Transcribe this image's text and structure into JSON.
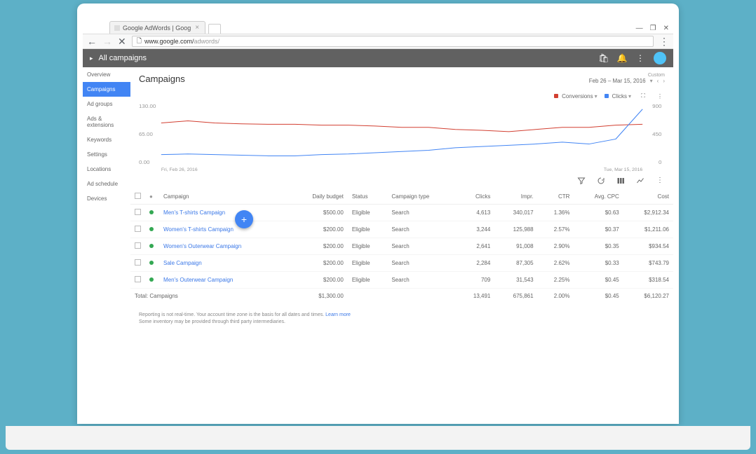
{
  "browser": {
    "tab_title": "Google AdWords | Goog",
    "url_host": "www.google.com/",
    "url_path": "adwords/"
  },
  "header": {
    "title": "All campaigns"
  },
  "sidebar": {
    "items": [
      {
        "label": "Overview",
        "active": false
      },
      {
        "label": "Campaigns",
        "active": true
      },
      {
        "label": "Ad groups",
        "active": false
      },
      {
        "label": "Ads & extensions",
        "active": false
      },
      {
        "label": "Keywords",
        "active": false
      },
      {
        "label": "Settings",
        "active": false
      },
      {
        "label": "Locations",
        "active": false
      },
      {
        "label": "Ad schedule",
        "active": false
      },
      {
        "label": "Devices",
        "active": false
      }
    ]
  },
  "page": {
    "title": "Campaigns",
    "date_label": "Custom",
    "date_range": "Feb 26 – Mar 15, 2016"
  },
  "chart_data": {
    "type": "line",
    "x_start": "Fri, Feb 26, 2016",
    "x_end": "Tue, Mar 15, 2016",
    "left_axis": {
      "label": "Conversions",
      "color": "#d23f31",
      "ticks": [
        0.0,
        65.0,
        130.0
      ]
    },
    "right_axis": {
      "label": "Clicks",
      "color": "#4285f4",
      "ticks": [
        0,
        450,
        900
      ]
    },
    "series": [
      {
        "name": "Conversions",
        "axis": "left",
        "color": "#d23f31",
        "values": [
          95,
          100,
          95,
          93,
          92,
          92,
          90,
          90,
          88,
          85,
          85,
          80,
          78,
          75,
          80,
          85,
          85,
          90,
          92
        ]
      },
      {
        "name": "Clicks",
        "axis": "right",
        "color": "#4285f4",
        "values": [
          150,
          160,
          150,
          140,
          130,
          130,
          150,
          160,
          180,
          200,
          220,
          260,
          280,
          300,
          320,
          350,
          320,
          400,
          880
        ]
      }
    ]
  },
  "table": {
    "columns": [
      "",
      "",
      "Campaign",
      "Daily budget",
      "Status",
      "Campaign type",
      "Clicks",
      "Impr.",
      "CTR",
      "Avg. CPC",
      "Cost"
    ],
    "rows": [
      {
        "name": "Men's T-shirts Campaign",
        "budget": "$500.00",
        "status": "Eligible",
        "type": "Search",
        "clicks": "4,613",
        "impr": "340,017",
        "ctr": "1.36%",
        "cpc": "$0.63",
        "cost": "$2,912.34"
      },
      {
        "name": "Women's T-shirts Campaign",
        "budget": "$200.00",
        "status": "Eligible",
        "type": "Search",
        "clicks": "3,244",
        "impr": "125,988",
        "ctr": "2.57%",
        "cpc": "$0.37",
        "cost": "$1,211.06"
      },
      {
        "name": "Women's Outerwear Campaign",
        "budget": "$200.00",
        "status": "Eligible",
        "type": "Search",
        "clicks": "2,641",
        "impr": "91,008",
        "ctr": "2.90%",
        "cpc": "$0.35",
        "cost": "$934.54"
      },
      {
        "name": "Sale Campaign",
        "budget": "$200.00",
        "status": "Eligible",
        "type": "Search",
        "clicks": "2,284",
        "impr": "87,305",
        "ctr": "2.62%",
        "cpc": "$0.33",
        "cost": "$743.79"
      },
      {
        "name": "Men's Outerwear Campaign",
        "budget": "$200.00",
        "status": "Eligible",
        "type": "Search",
        "clicks": "709",
        "impr": "31,543",
        "ctr": "2.25%",
        "cpc": "$0.45",
        "cost": "$318.54"
      }
    ],
    "total": {
      "label": "Total: Campaigns",
      "budget": "$1,300.00",
      "clicks": "13,491",
      "impr": "675,861",
      "ctr": "2.00%",
      "cpc": "$0.45",
      "cost": "$6,120.27"
    }
  },
  "footer": {
    "line1": "Reporting is not real-time. Your account time zone is the basis for all dates and times.",
    "learn_more": "Learn more",
    "line2": "Some inventory may be provided through third party intermediaries."
  }
}
